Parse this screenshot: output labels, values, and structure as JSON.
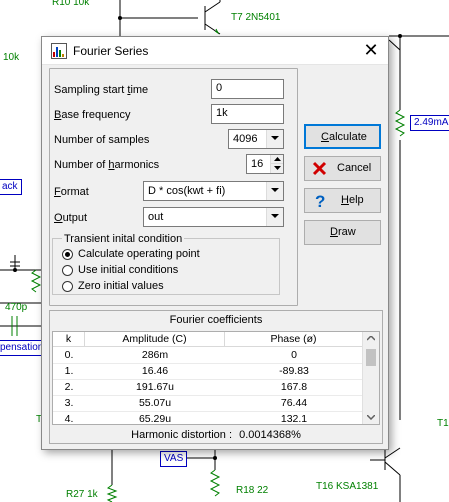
{
  "dialog": {
    "title": "Fourier Series",
    "close_glyph": "✕",
    "fields": {
      "sampling_start": {
        "label_pre": "Sampling start ",
        "label_key": "t",
        "label_post": "ime",
        "value": "0"
      },
      "base_frequency": {
        "label_key": "B",
        "label_post": "ase frequency",
        "value": "1k"
      },
      "num_samples": {
        "label": "Number of samples",
        "value": "4096"
      },
      "num_harmonics": {
        "label_pre": "Number of ",
        "label_key": "h",
        "label_post": "armonics",
        "value": "16"
      },
      "format": {
        "label_key": "F",
        "label_post": "ormat",
        "value": "D * cos(kwt + fi)"
      },
      "output": {
        "label_key": "O",
        "label_post": "utput",
        "value": "out"
      }
    },
    "transient": {
      "legend": "Transient inital condition",
      "options": [
        {
          "label": "Calculate operating point",
          "checked": true
        },
        {
          "label": "Use initial conditions",
          "checked": false
        },
        {
          "label": "Zero initial values",
          "checked": false
        }
      ]
    },
    "buttons": {
      "calculate": {
        "key": "C",
        "rest": "alculate"
      },
      "cancel": "Cancel",
      "help": {
        "key": "H",
        "rest": "elp"
      },
      "draw": {
        "key": "D",
        "rest": "raw"
      }
    },
    "coefficients": {
      "title": "Fourier coefficients",
      "columns": [
        "k",
        "Amplitude (C)",
        "Phase (ø)"
      ],
      "rows": [
        [
          "0.",
          "286m",
          "0"
        ],
        [
          "1.",
          "16.46",
          "-89.83"
        ],
        [
          "2.",
          "191.67u",
          "167.8"
        ],
        [
          "3.",
          "55.07u",
          "76.44"
        ],
        [
          "4.",
          "65.29u",
          "132.1"
        ]
      ],
      "distortion_label": "Harmonic distortion :",
      "distortion_value": "0.0014368%"
    }
  },
  "schematic": {
    "labels": {
      "r10": "R10 10k",
      "t7": "T7 2N5401",
      "r_10k_left": "10k",
      "current": "2.49mA",
      "ack": "ack",
      "cap": "470p",
      "pensation": "pensation",
      "vas": "VAS",
      "r27": "R27 1k",
      "r18": "R18 22",
      "t16": "T16 KSA1381",
      "t_left": "T",
      "t_right": "T1"
    }
  },
  "colors": {
    "wire": "#000000",
    "component": "#008000",
    "label_blue": "#0000c0",
    "default_button_border": "#0078d7",
    "cancel_icon": "#d00000",
    "help_icon": "#0060c0"
  }
}
